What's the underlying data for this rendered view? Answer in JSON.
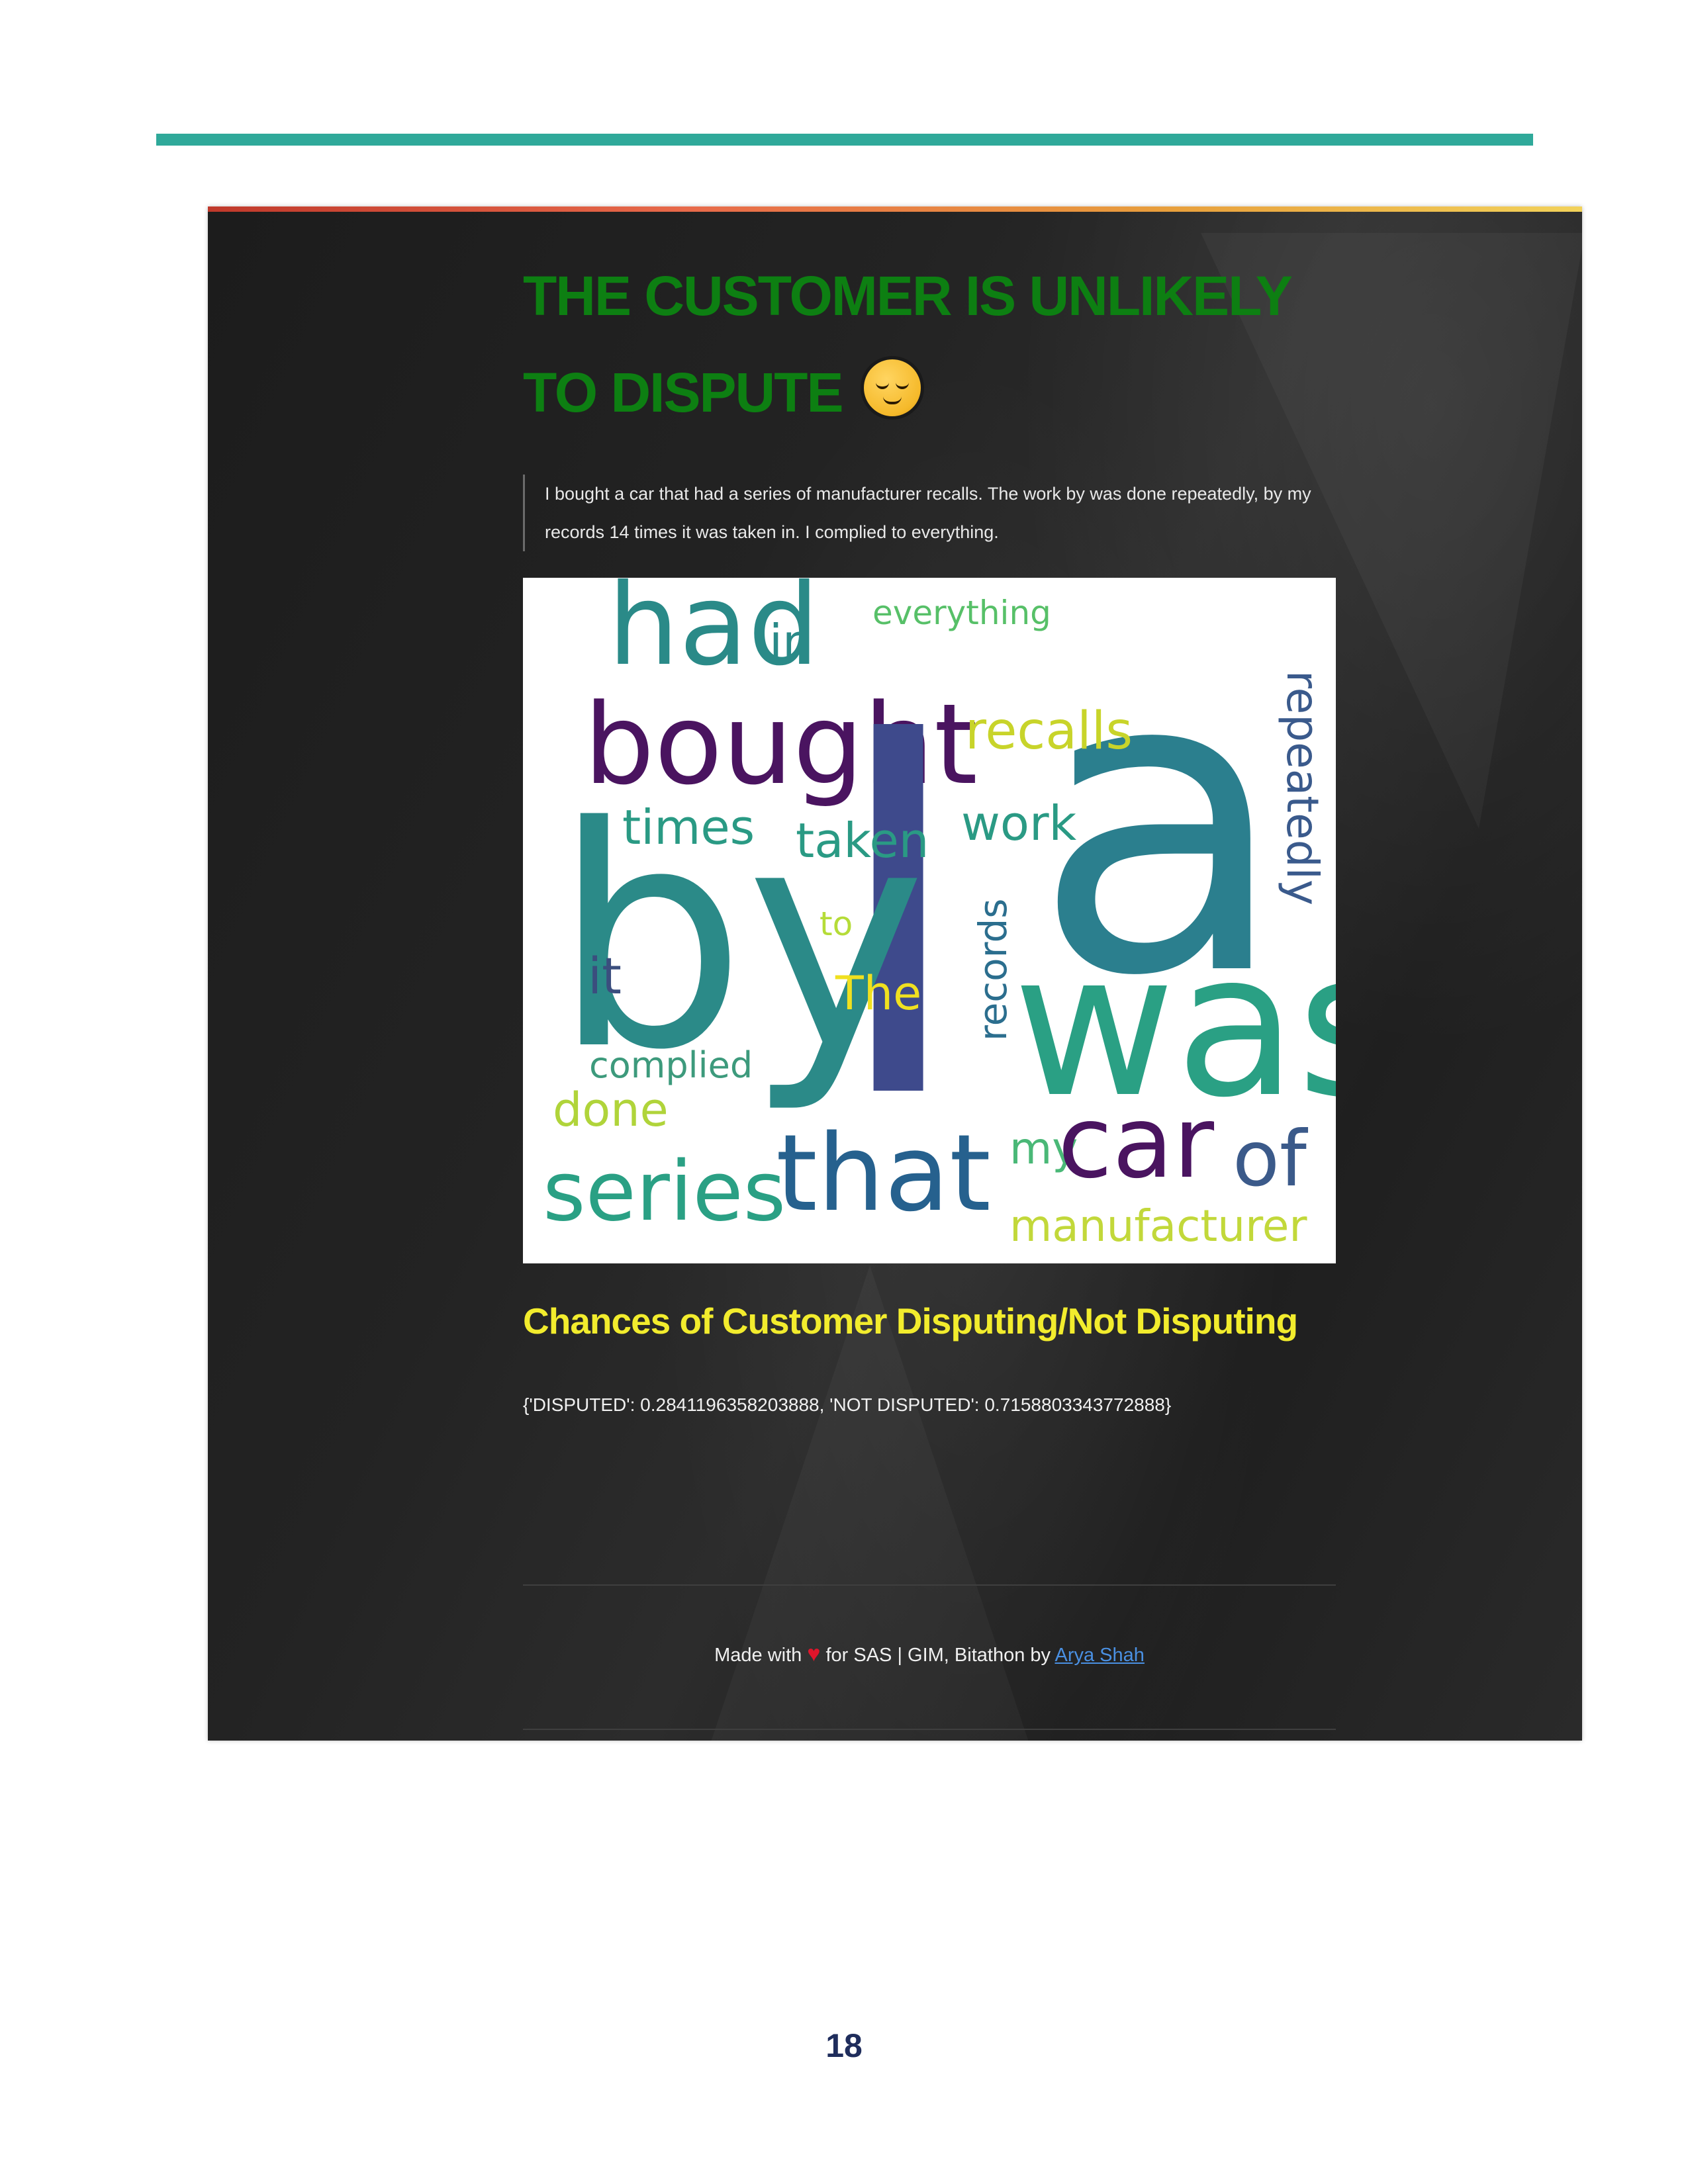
{
  "headline": {
    "text": "THE CUSTOMER IS UNLIKELY TO DISPUTE",
    "icon": "relieved-face-emoji"
  },
  "complaint_text": "I bought a car that had a series of manufacturer recalls. The work by was done repeatedly, by my records 14 times it was taken in. I complied to everything.",
  "wordcloud": {
    "words": [
      "had",
      "in",
      "everything",
      "bought",
      "I",
      "a",
      "recalls",
      "repeatedly",
      "times",
      "taken",
      "work",
      "by",
      "to",
      "records",
      "it",
      "The",
      "was",
      "complied",
      "done",
      "series",
      "that",
      "my",
      "car",
      "of",
      "manufacturer"
    ]
  },
  "chances": {
    "title": "Chances of Customer Disputing/Not Disputing",
    "values_text": "{'DISPUTED': 0.2841196358203888, 'NOT DISPUTED': 0.7158803343772888}"
  },
  "footer": {
    "made_with": "Made with",
    "heart": "♥",
    "middle": "for SAS | GIM, Bitathon by",
    "author_link": "Arya Shah"
  },
  "page_number": "18",
  "colors": {
    "teal_rule": "#2fa99a",
    "headline_green": "#0d7f12",
    "chances_yellow": "#f2ec2d",
    "link_blue": "#4a90e2",
    "heart_red": "#e0152b",
    "page_number_navy": "#1f2d5c"
  }
}
